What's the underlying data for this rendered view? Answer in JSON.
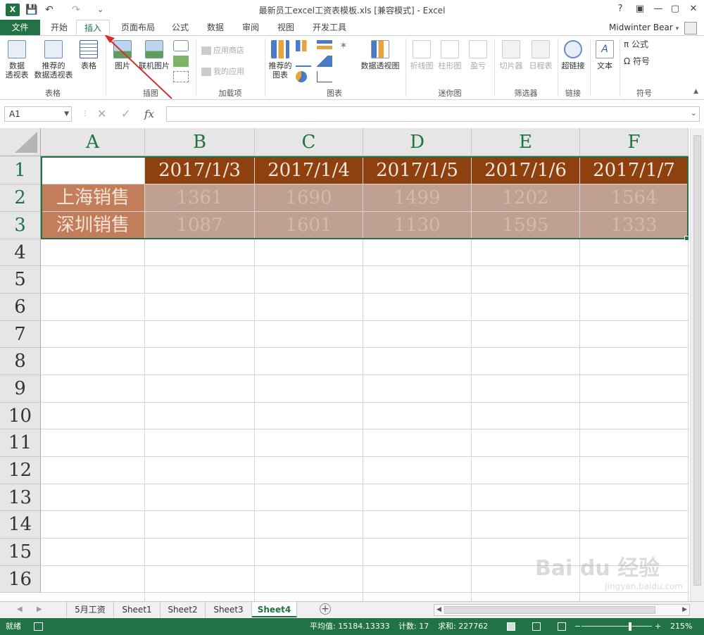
{
  "app": {
    "title": "最新员工excel工资表模板.xls  [兼容模式] - Excel",
    "logo": "X",
    "user_name": "Midwinter Bear",
    "help": "?",
    "minimize": "—",
    "restore": "▢",
    "close": "✕",
    "ribbon_toggle": "▣"
  },
  "qat": {
    "save": "💾",
    "undo": "↶",
    "redo": "↷",
    "more": "⌄"
  },
  "tabs": [
    "开始",
    "插入",
    "页面布局",
    "公式",
    "数据",
    "审阅",
    "视图",
    "开发工具"
  ],
  "file_tab": "文件",
  "active_tab": "插入",
  "ribbon": {
    "groups": {
      "tables": "表格",
      "illustrations": "插图",
      "addins": "加载项",
      "charts": "图表",
      "sparklines": "迷你图",
      "filters": "筛选器",
      "links": "链接",
      "symbols": "符号"
    },
    "buttons": {
      "pivot_table": "数据\n透视表",
      "recommended_pivot": "推荐的\n数据透视表",
      "table": "表格",
      "picture": "图片",
      "online_picture": "联机图片",
      "app_store": "应用商店",
      "my_apps": "我的应用",
      "recommended_charts": "推荐的\n图表",
      "pivot_chart": "数据透视图",
      "line_sparkline": "折线图",
      "column_sparkline": "柱形图",
      "winloss_sparkline": "盈亏",
      "slicer": "切片器",
      "timeline": "日程表",
      "hyperlink": "超链接",
      "text": "文本",
      "equation": "π 公式",
      "symbol": "Ω 符号"
    }
  },
  "formula_bar": {
    "name_box": "A1",
    "cancel": "✕",
    "enter": "✓",
    "fx": "fx",
    "value": ""
  },
  "columns": [
    "A",
    "B",
    "C",
    "D",
    "E",
    "F"
  ],
  "rows": [
    "1",
    "2",
    "3",
    "4",
    "5",
    "6",
    "7",
    "8",
    "9",
    "10",
    "11",
    "12",
    "13",
    "14",
    "15",
    "16"
  ],
  "cells": {
    "header_row": [
      "",
      "2017/1/3",
      "2017/1/4",
      "2017/1/5",
      "2017/1/6",
      "2017/1/7"
    ],
    "row2": [
      "上海销售",
      "1361",
      "1690",
      "1499",
      "1202",
      "1564"
    ],
    "row3": [
      "深圳销售",
      "1087",
      "1601",
      "1130",
      "1595",
      "1333"
    ]
  },
  "colors": {
    "excel_green": "#217346",
    "header_fill": "#8e400f",
    "label_fill": "#c27e5b",
    "data_fill": "#c0a090",
    "annotation_arrow": "#d43030"
  },
  "sheets": [
    "5月工资",
    "Sheet1",
    "Sheet2",
    "Sheet3",
    "Sheet4"
  ],
  "active_sheet": "Sheet4",
  "status": {
    "ready": "就绪",
    "average": "平均值: 15184.13333",
    "count": "计数: 17",
    "sum": "求和: 227762",
    "zoom": "215%",
    "zoom_minus": "−",
    "zoom_plus": "+"
  },
  "watermark": {
    "brand": "Bai du 经验",
    "url": "jingyan.baidu.com"
  }
}
